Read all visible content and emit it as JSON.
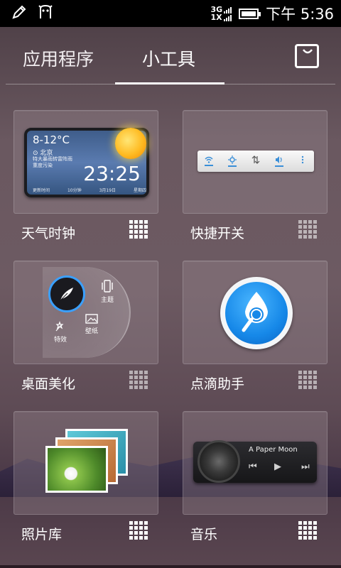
{
  "status_bar": {
    "network_top": "3G",
    "network_bottom": "1X",
    "time": "下午 5:36"
  },
  "tabs": {
    "apps": "应用程序",
    "widgets": "小工具",
    "active": "widgets"
  },
  "widgets": {
    "weather_clock": {
      "label": "天气时钟",
      "temperature": "8-12°C",
      "city": "北京",
      "forecast_lines": [
        "特大暴雨转雷阵雨",
        "重度污染"
      ],
      "time": "23:25",
      "footer": [
        "更新时间",
        "10分钟",
        "3月19日",
        "星期四"
      ]
    },
    "quick_switch": {
      "label": "快捷开关"
    },
    "desktop_beautify": {
      "label": "桌面美化",
      "options": [
        "主题",
        "壁纸",
        "特效"
      ]
    },
    "drip_assistant": {
      "label": "点滴助手"
    },
    "photo_gallery": {
      "label": "照片库"
    },
    "music": {
      "label": "音乐",
      "song_title": "A Paper Moon"
    }
  },
  "colors": {
    "accent_blue": "#1688e8",
    "sun": "#ffbb22"
  }
}
